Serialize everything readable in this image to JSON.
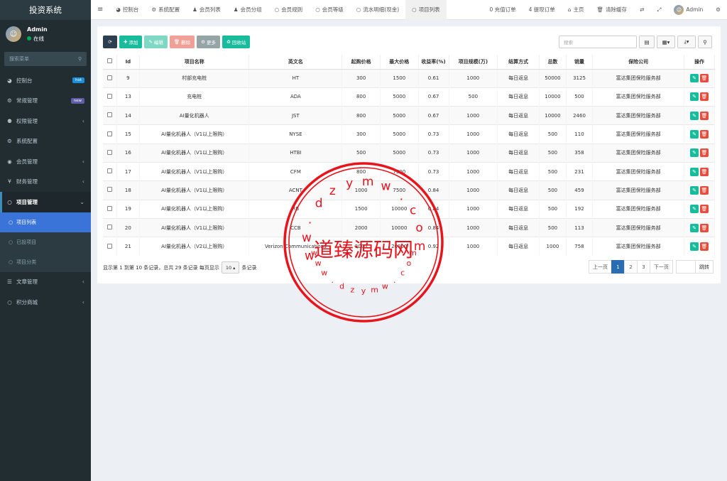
{
  "app_title": "投资系统",
  "user": {
    "name": "Admin",
    "status": "在线"
  },
  "sidebar": {
    "search_placeholder": "搜索菜单",
    "items": [
      {
        "icon": "dashboard-icon",
        "label": "控制台",
        "badge": "hot",
        "badge_color": "#1a8fdc"
      },
      {
        "icon": "gears-icon",
        "label": "常规管理",
        "badge": "new",
        "badge_color": "#605ca8"
      },
      {
        "icon": "group-icon",
        "label": "权限管理",
        "chev": "‹"
      },
      {
        "icon": "gear-icon",
        "label": "系统配置"
      },
      {
        "icon": "user-circle-icon",
        "label": "会员管理",
        "chev": "‹"
      },
      {
        "icon": "yen-icon",
        "label": "财务管理",
        "chev": "‹"
      },
      {
        "icon": "circle-icon",
        "label": "项目管理",
        "chev": "⌄"
      }
    ],
    "sub_items": [
      {
        "label": "项目列表",
        "current": true
      },
      {
        "label": "已投项目",
        "current": false
      },
      {
        "label": "项目分类",
        "current": false
      }
    ],
    "items2": [
      {
        "icon": "list-icon",
        "label": "文章管理",
        "chev": "‹"
      },
      {
        "icon": "circle-icon",
        "label": "积分商城",
        "chev": "‹"
      }
    ]
  },
  "topbar": {
    "tabs": [
      "控制台",
      "系统配置",
      "会员列表",
      "会员分组",
      "会员规则",
      "会员等级",
      "流水明细(现金)",
      "项目列表"
    ],
    "tab_icons": [
      "dashboard-icon",
      "gear-icon",
      "user-icon",
      "users-icon",
      "circle-icon",
      "circle-icon",
      "circle-icon",
      "circle-icon"
    ],
    "right": [
      "0 充值订单",
      "4 提现订单",
      "主页",
      "清除缓存"
    ],
    "admin": "Admin"
  },
  "toolbar": {
    "refresh": "⟳",
    "add": "添加",
    "edit": "编辑",
    "delete": "删除",
    "more": "更多",
    "recycle": "回收站",
    "search_placeholder": "搜索"
  },
  "table": {
    "columns": [
      "Id",
      "项目名称",
      "英文名",
      "起购价格",
      "最大价格",
      "收益率(%)",
      "项目规模(万)",
      "结算方式",
      "总数",
      "销量",
      "保险公司",
      "操作"
    ],
    "rows": [
      [
        "9",
        "村部充电桩",
        "HT",
        "300",
        "1500",
        "0.61",
        "1000",
        "每日返息",
        "50000",
        "3125",
        "富达集团保险服务部"
      ],
      [
        "13",
        "充电桩",
        "ADA",
        "800",
        "5000",
        "0.67",
        "500",
        "每日返息",
        "10000",
        "500",
        "富达集团保险服务部"
      ],
      [
        "14",
        "AI量化机器人",
        "JST",
        "800",
        "5000",
        "0.67",
        "1000",
        "每日返息",
        "10000",
        "2460",
        "富达集团保险服务部"
      ],
      [
        "15",
        "AI量化机器人（V1以上限购）",
        "NYSE",
        "300",
        "5000",
        "0.73",
        "1000",
        "每日返息",
        "500",
        "110",
        "富达集团保险服务部"
      ],
      [
        "16",
        "AI量化机器人（V1以上限购）",
        "HTBI",
        "500",
        "5000",
        "0.73",
        "1000",
        "每日返息",
        "500",
        "358",
        "富达集团保险服务部"
      ],
      [
        "17",
        "AI量化机器人（V1以上限购）",
        "CFM",
        "800",
        "7500",
        "0.73",
        "1000",
        "每日返息",
        "500",
        "231",
        "富达集团保险服务部"
      ],
      [
        "18",
        "AI量化机器人（V1以上限购）",
        "ACNT",
        "1000",
        "7500",
        "0.84",
        "1000",
        "每日返息",
        "500",
        "459",
        "富达集团保险服务部"
      ],
      [
        "19",
        "AI量化机器人（V1以上限购）",
        "RB",
        "1500",
        "10000",
        "0.84",
        "1000",
        "每日返息",
        "500",
        "192",
        "富达集团保险服务部"
      ],
      [
        "20",
        "AI量化机器人（V1以上限购）",
        "CCB",
        "2000",
        "10000",
        "0.84",
        "1000",
        "每日返息",
        "500",
        "113",
        "富达集团保险服务部"
      ],
      [
        "21",
        "AI量化机器人（V2以上限购）",
        "Verizon Communications",
        "3000",
        "20000",
        "0.92",
        "1000",
        "每日返息",
        "1000",
        "758",
        "富达集团保险服务部"
      ]
    ]
  },
  "pager": {
    "info_prefix": "显示第 1 到第 10 条记录，总共 29 条记录 每页显示",
    "page_size": "10 ▴",
    "info_suffix": "条记录",
    "prev": "上一页",
    "pages": [
      "1",
      "2",
      "3"
    ],
    "next": "下一页",
    "jump": "跳转"
  },
  "watermark": {
    "center": "道臻源码网",
    "top_chars": [
      "w",
      "w",
      ".",
      "d",
      "z",
      "y",
      "m",
      "w",
      ".",
      "c",
      "o",
      "m"
    ],
    "bottom_chars": [
      "w",
      "w",
      "w",
      ".",
      "d",
      "z",
      "y",
      "m",
      "w",
      ".",
      "c",
      "o",
      "m"
    ]
  },
  "colors": {
    "add": "#18bc9c",
    "edit": "#7fd8c4",
    "delete": "#f0a096",
    "more": "#95a5a6",
    "recycle": "#18bc9c",
    "refresh": "#2c3e50",
    "op_edit": "#18bc9c",
    "op_del": "#e74c3c",
    "stamp": "#e8141c"
  }
}
